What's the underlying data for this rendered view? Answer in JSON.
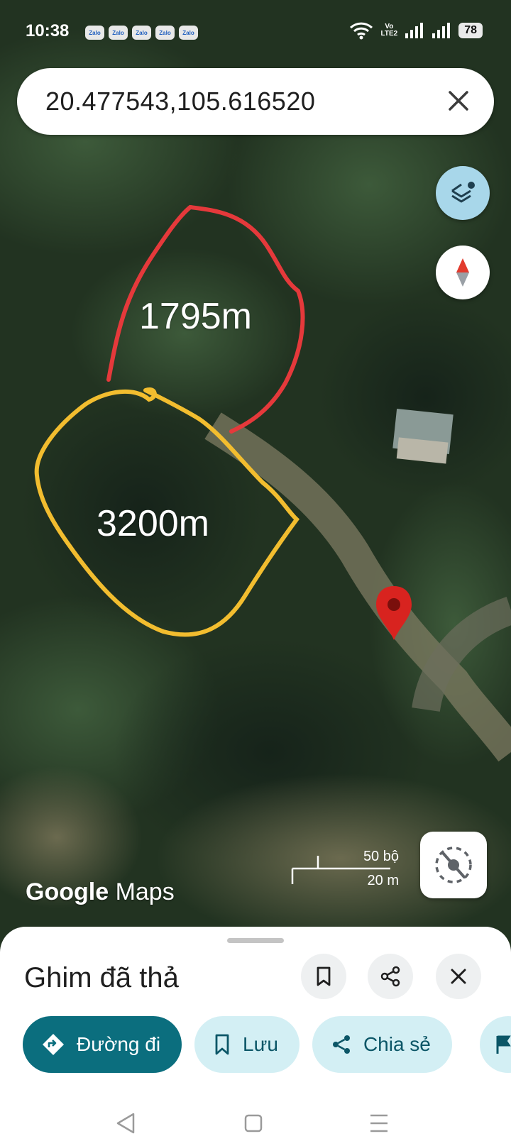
{
  "status_bar": {
    "time": "10:38",
    "notifications": [
      "Zalo",
      "Zalo",
      "Zalo",
      "Zalo",
      "Zalo"
    ],
    "network_top": "Vo",
    "network_bottom": "LTE2",
    "battery": "78"
  },
  "search": {
    "value": "20.477543,105.616520",
    "close_icon": "close-icon"
  },
  "map": {
    "type": "satellite",
    "annotations": [
      {
        "text": "1795m",
        "stroke_color": "#e5393b"
      },
      {
        "text": "3200m",
        "stroke_color": "#f2bd2f"
      }
    ],
    "pin_color": "#d8231f",
    "scale": {
      "imperial": "50 bộ",
      "metric": "20 m"
    },
    "attribution": {
      "brand": "Google",
      "product": "Maps"
    },
    "controls": {
      "layers": "layers-icon",
      "compass": "compass-icon",
      "locate": "location-off-icon"
    }
  },
  "sheet": {
    "title": "Ghim đã thả",
    "header_buttons": [
      "bookmark-icon",
      "share-icon",
      "close-icon"
    ],
    "chips": [
      {
        "label": "Đường đi",
        "icon": "directions-icon",
        "primary": true
      },
      {
        "label": "Lưu",
        "icon": "bookmark-icon",
        "primary": false
      },
      {
        "label": "Chia sẻ",
        "icon": "share-icon",
        "primary": false
      }
    ]
  },
  "colors": {
    "accent": "#0b6e7e",
    "chip_bg": "#d3eff4",
    "layer_button": "#a8d7ea"
  }
}
